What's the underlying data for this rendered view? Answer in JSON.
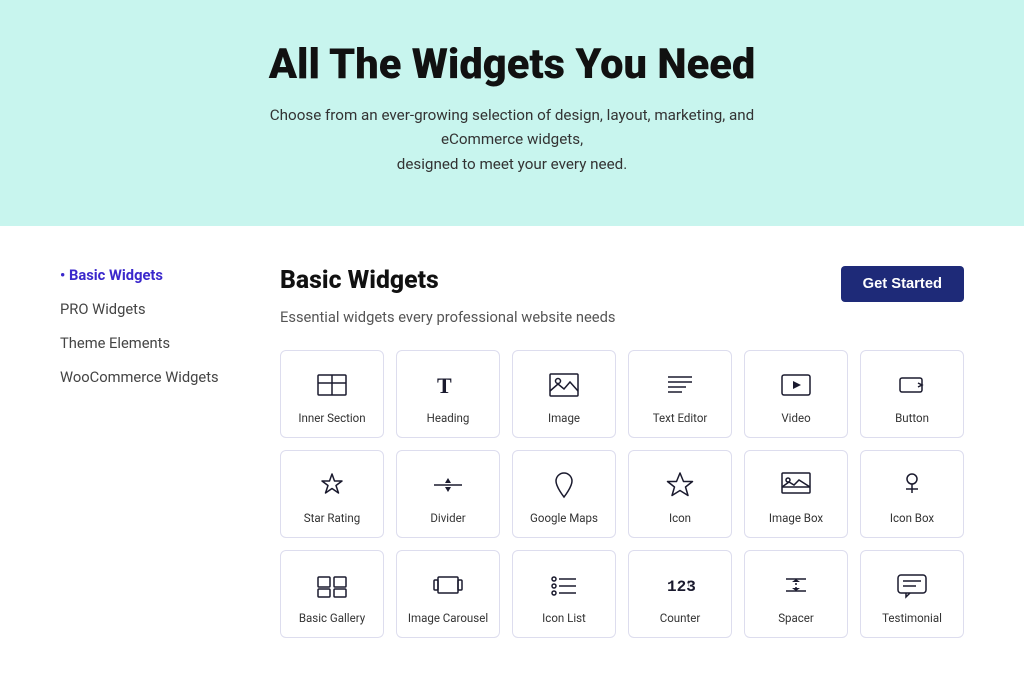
{
  "hero": {
    "title": "All The Widgets You Need",
    "subtitle": "Choose from an ever-growing selection of design, layout, marketing, and eCommerce widgets,\ndesigned to meet your every need."
  },
  "sidebar": {
    "items": [
      {
        "id": "basic",
        "label": "Basic Widgets",
        "active": true
      },
      {
        "id": "pro",
        "label": "PRO Widgets",
        "active": false
      },
      {
        "id": "theme",
        "label": "Theme Elements",
        "active": false
      },
      {
        "id": "woo",
        "label": "WooCommerce Widgets",
        "active": false
      }
    ]
  },
  "content": {
    "section_title": "Basic Widgets",
    "section_subtitle": "Essential widgets every professional website needs",
    "cta_label": "Get Started"
  },
  "widgets": [
    {
      "id": "inner-section",
      "label": "Inner Section"
    },
    {
      "id": "heading",
      "label": "Heading"
    },
    {
      "id": "image",
      "label": "Image"
    },
    {
      "id": "text-editor",
      "label": "Text Editor"
    },
    {
      "id": "video",
      "label": "Video"
    },
    {
      "id": "button",
      "label": "Button"
    },
    {
      "id": "star-rating",
      "label": "Star Rating"
    },
    {
      "id": "divider",
      "label": "Divider"
    },
    {
      "id": "google-maps",
      "label": "Google Maps"
    },
    {
      "id": "icon",
      "label": "Icon"
    },
    {
      "id": "image-box",
      "label": "Image Box"
    },
    {
      "id": "icon-box",
      "label": "Icon Box"
    },
    {
      "id": "basic-gallery",
      "label": "Basic Gallery"
    },
    {
      "id": "image-carousel",
      "label": "Image Carousel"
    },
    {
      "id": "icon-list",
      "label": "Icon List"
    },
    {
      "id": "counter",
      "label": "Counter"
    },
    {
      "id": "spacer",
      "label": "Spacer"
    },
    {
      "id": "testimonial",
      "label": "Testimonial"
    }
  ]
}
